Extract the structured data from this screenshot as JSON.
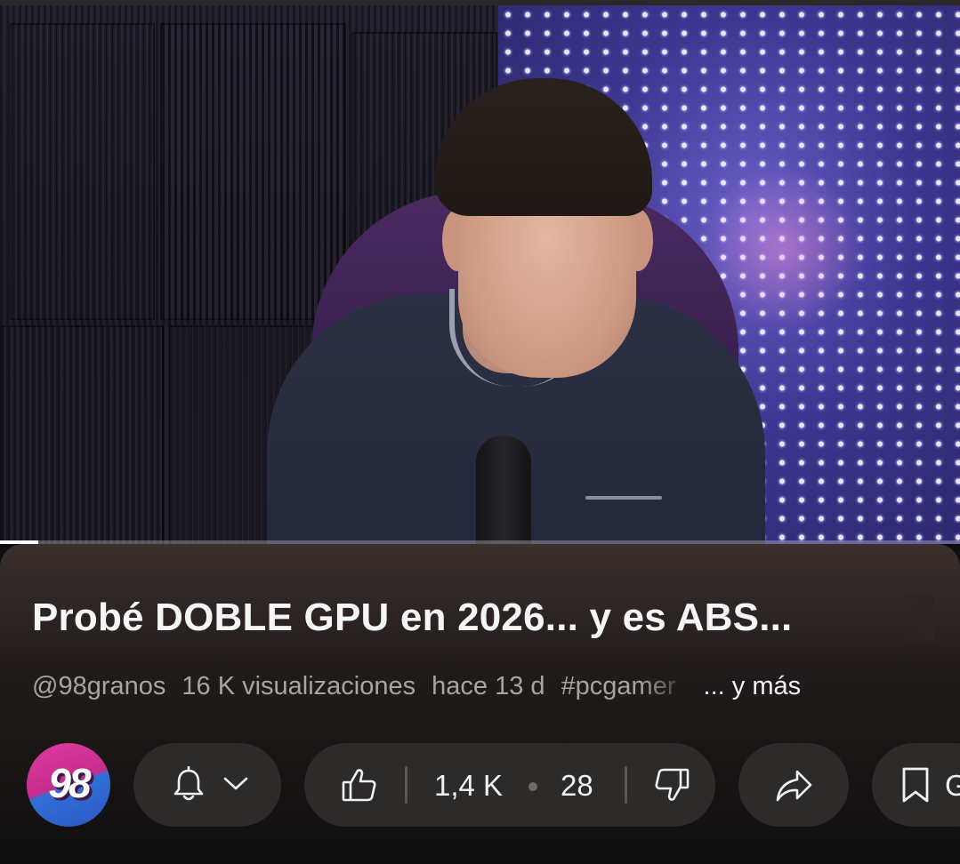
{
  "video": {
    "progress_fraction": 0.04
  },
  "title": "Probé DOBLE GPU en 2026... y es ABS...",
  "meta": {
    "channel_handle": "@98granos",
    "views": "16 K visualizaciones",
    "age": "hace 13 d",
    "hashtag": "#pcgamer",
    "more": "... y más"
  },
  "avatar": {
    "text": "98"
  },
  "actions": {
    "likes": "1,4 K",
    "comments": "28",
    "save_label": "G"
  },
  "icons": {
    "bell": "bell-icon",
    "chevron": "chevron-down-icon",
    "like": "thumbs-up-icon",
    "dislike": "thumbs-down-icon",
    "share": "share-arrow-icon",
    "save": "bookmark-icon"
  },
  "colors": {
    "background": "#0f0e0e",
    "pill": "#2d2b2a",
    "text_primary": "#f1f1f1",
    "text_secondary": "#a8a4a3",
    "avatar_pink": "#e23a9f",
    "avatar_blue": "#2f6fd6"
  }
}
